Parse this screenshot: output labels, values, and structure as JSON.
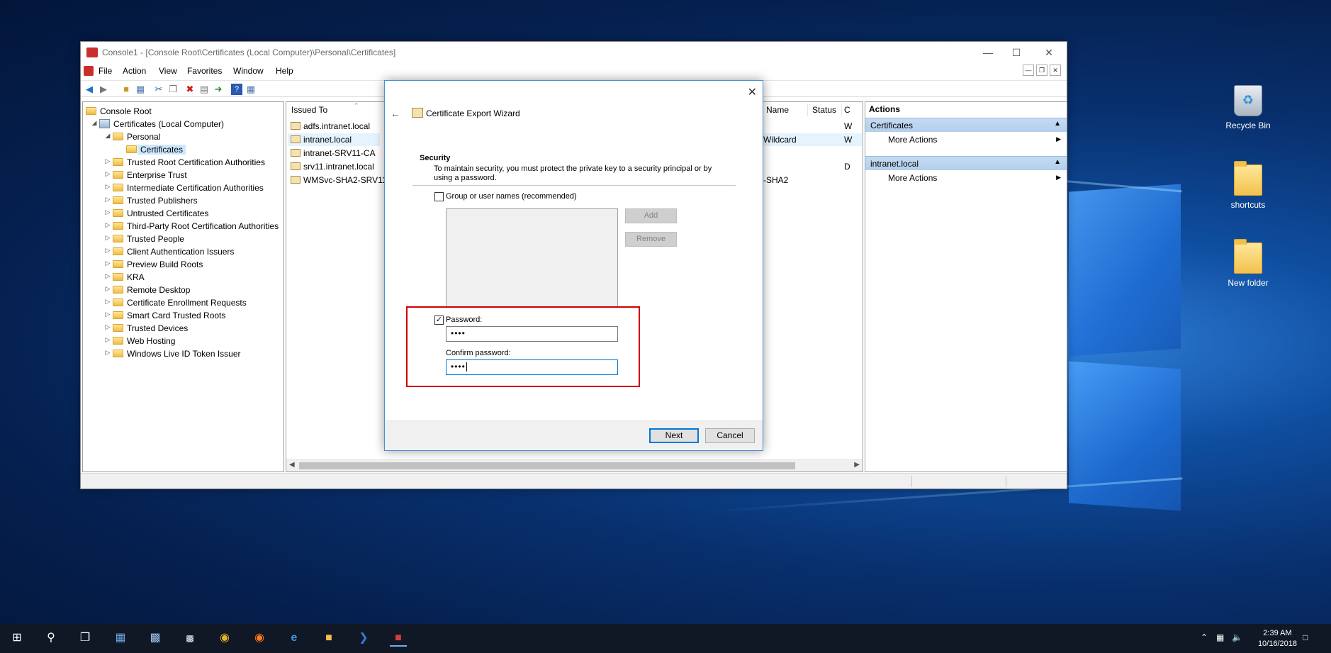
{
  "desktop": {
    "icons": [
      {
        "label": "Recycle Bin",
        "icon": "recycle-bin-icon"
      },
      {
        "label": "shortcuts",
        "icon": "folder-icon"
      },
      {
        "label": "New folder",
        "icon": "folder-icon"
      }
    ]
  },
  "mmc": {
    "title": "Console1 - [Console Root\\Certificates (Local Computer)\\Personal\\Certificates]",
    "menu": [
      "File",
      "Action",
      "View",
      "Favorites",
      "Window",
      "Help"
    ],
    "tree": [
      {
        "label": "Console Root",
        "depth": 0,
        "icon": "folder",
        "expander": ""
      },
      {
        "label": "Certificates (Local Computer)",
        "depth": 1,
        "icon": "computer",
        "expander": "expanded"
      },
      {
        "label": "Personal",
        "depth": 2,
        "icon": "folder",
        "expander": "expanded"
      },
      {
        "label": "Certificates",
        "depth": 3,
        "icon": "folder",
        "expander": "",
        "selected": true
      },
      {
        "label": "Trusted Root Certification Authorities",
        "depth": 2,
        "icon": "folder",
        "expander": "collapsed"
      },
      {
        "label": "Enterprise Trust",
        "depth": 2,
        "icon": "folder",
        "expander": "collapsed"
      },
      {
        "label": "Intermediate Certification Authorities",
        "depth": 2,
        "icon": "folder",
        "expander": "collapsed"
      },
      {
        "label": "Trusted Publishers",
        "depth": 2,
        "icon": "folder",
        "expander": "collapsed"
      },
      {
        "label": "Untrusted Certificates",
        "depth": 2,
        "icon": "folder",
        "expander": "collapsed"
      },
      {
        "label": "Third-Party Root Certification Authorities",
        "depth": 2,
        "icon": "folder",
        "expander": "collapsed"
      },
      {
        "label": "Trusted People",
        "depth": 2,
        "icon": "folder",
        "expander": "collapsed"
      },
      {
        "label": "Client Authentication Issuers",
        "depth": 2,
        "icon": "folder",
        "expander": "collapsed"
      },
      {
        "label": "Preview Build Roots",
        "depth": 2,
        "icon": "folder",
        "expander": "collapsed"
      },
      {
        "label": "KRA",
        "depth": 2,
        "icon": "folder",
        "expander": "collapsed"
      },
      {
        "label": "Remote Desktop",
        "depth": 2,
        "icon": "folder",
        "expander": "collapsed"
      },
      {
        "label": "Certificate Enrollment Requests",
        "depth": 2,
        "icon": "folder",
        "expander": "collapsed"
      },
      {
        "label": "Smart Card Trusted Roots",
        "depth": 2,
        "icon": "folder",
        "expander": "collapsed"
      },
      {
        "label": "Trusted Devices",
        "depth": 2,
        "icon": "folder",
        "expander": "collapsed"
      },
      {
        "label": "Web Hosting",
        "depth": 2,
        "icon": "folder",
        "expander": "collapsed"
      },
      {
        "label": "Windows Live ID Token Issuer",
        "depth": 2,
        "icon": "folder",
        "expander": "collapsed"
      }
    ],
    "list": {
      "columns": [
        "Issued To",
        "Name",
        "Status",
        "C"
      ],
      "rows": [
        {
          "issued_to": "adfs.intranet.local",
          "name": "",
          "status": "",
          "c": "W"
        },
        {
          "issued_to": "intranet.local",
          "name": "Wildcard",
          "status": "",
          "c": "W",
          "selected": true
        },
        {
          "issued_to": "intranet-SRV11-CA",
          "name": "",
          "status": "",
          "c": ""
        },
        {
          "issued_to": "srv11.intranet.local",
          "name": "",
          "status": "",
          "c": "D"
        },
        {
          "issued_to": "WMSvc-SHA2-SRV11",
          "name": "-SHA2",
          "status": "",
          "c": ""
        }
      ]
    },
    "actions": {
      "header": "Actions",
      "groups": [
        {
          "title": "Certificates",
          "item": "More Actions"
        },
        {
          "title": "intranet.local",
          "item": "More Actions"
        }
      ]
    }
  },
  "wizard": {
    "title": "Certificate Export Wizard",
    "section_title": "Security",
    "section_desc": "To maintain security, you must protect the private key to a security principal or by using a password.",
    "group_checkbox_label": "Group or user names (recommended)",
    "group_checked": false,
    "add_label": "Add",
    "remove_label": "Remove",
    "password_checkbox_label": "Password:",
    "password_checked": true,
    "password_value": "••••",
    "confirm_label": "Confirm password:",
    "confirm_value": "••••",
    "next_label": "Next",
    "cancel_label": "Cancel"
  },
  "taskbar": {
    "time": "2:39 AM",
    "date": "10/16/2018"
  }
}
